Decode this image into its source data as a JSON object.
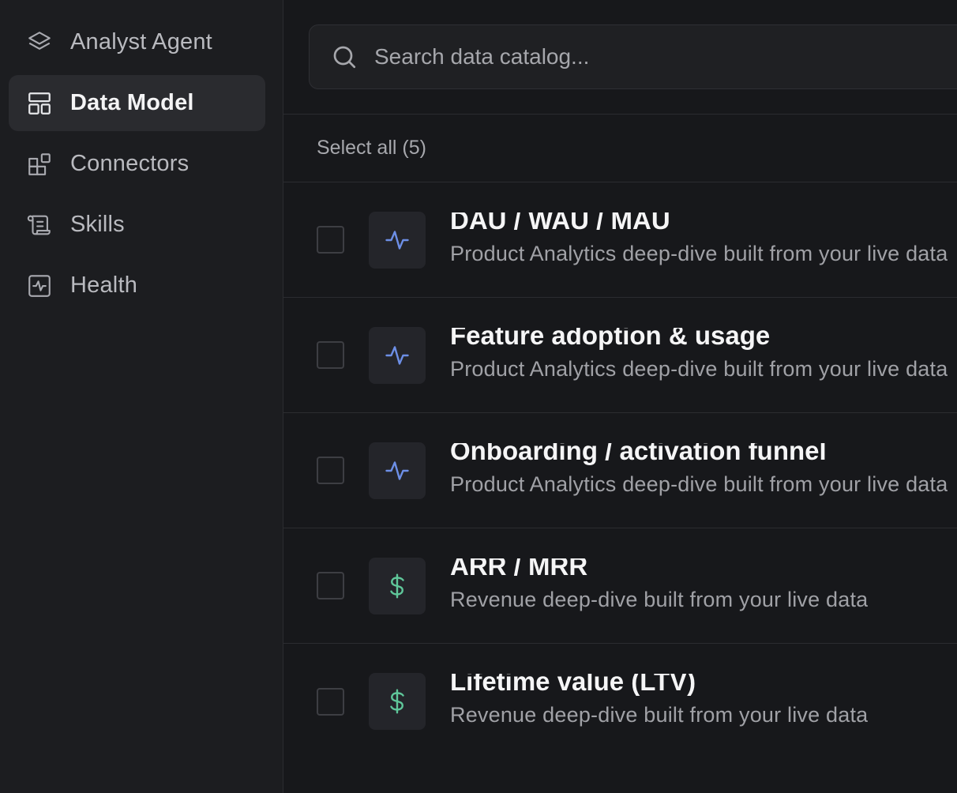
{
  "sidebar": {
    "items": [
      {
        "label": "Analyst Agent",
        "icon": "layers-icon",
        "active": false
      },
      {
        "label": "Data Model",
        "icon": "layout-icon",
        "active": true
      },
      {
        "label": "Connectors",
        "icon": "blocks-icon",
        "active": false
      },
      {
        "label": "Skills",
        "icon": "scroll-icon",
        "active": false
      },
      {
        "label": "Health",
        "icon": "activity-square-icon",
        "active": false
      }
    ]
  },
  "search": {
    "placeholder": "Search data catalog...",
    "value": ""
  },
  "select_all_label": "Select all (5)",
  "catalog": {
    "items": [
      {
        "title": "DAU / WAU / MAU",
        "description": "Product Analytics deep-dive built from your live data",
        "icon": "activity-icon",
        "checked": false
      },
      {
        "title": "Feature adoption & usage",
        "description": "Product Analytics deep-dive built from your live data",
        "icon": "activity-icon",
        "checked": false
      },
      {
        "title": "Onboarding / activation funnel",
        "description": "Product Analytics deep-dive built from your live data",
        "icon": "activity-icon",
        "checked": false
      },
      {
        "title": "ARR / MRR",
        "description": "Revenue deep-dive built from your live data",
        "icon": "dollar-icon",
        "checked": false
      },
      {
        "title": "Lifetime value (LTV)",
        "description": "Revenue deep-dive built from your live data",
        "icon": "dollar-icon",
        "checked": false
      }
    ]
  },
  "colors": {
    "background": "#17181b",
    "sidebar": "#1c1d20",
    "active_item": "#2a2b2f",
    "analytics_icon": "#6d8fe6",
    "revenue_icon": "#5fc79a"
  }
}
